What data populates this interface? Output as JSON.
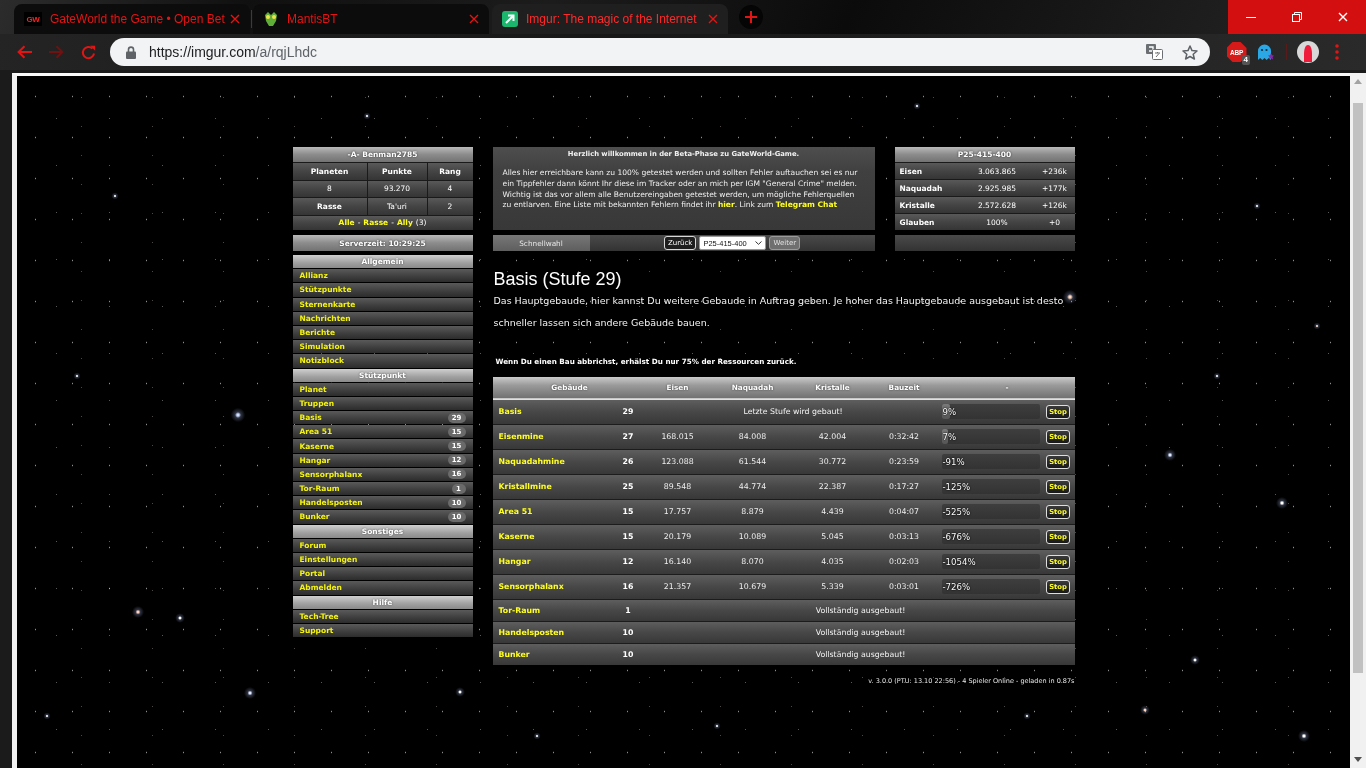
{
  "browser": {
    "tabs": [
      {
        "kind": "gw",
        "favicon_text": "GW",
        "title": "GateWorld the Game • Open Bet",
        "selected": false
      },
      {
        "kind": "mantis",
        "title": "MantisBT",
        "selected": false
      },
      {
        "kind": "imgur",
        "title": "Imgur: The magic of the Internet",
        "selected": true
      }
    ],
    "url": {
      "origin": "https://imgur.com",
      "path": "/a/rqjLhdc"
    },
    "extensions": [
      {
        "kind": "abp",
        "label": "ABP",
        "badge": "4"
      },
      {
        "kind": "ghost"
      }
    ]
  },
  "player_panel": {
    "title": "-A- Benman2785",
    "columns": [
      "Planeten",
      "Punkte",
      "Rang"
    ],
    "rows": [
      {
        "kind": "values",
        "cells": [
          "8",
          "93.270",
          "4"
        ]
      },
      {
        "kind": "labeled",
        "cells": [
          "Rasse",
          "Ta'uri",
          "2"
        ]
      }
    ],
    "filters": [
      {
        "kind": "link",
        "text": "Alle"
      },
      {
        "kind": "separator",
        "text": "-"
      },
      {
        "kind": "link",
        "text": "Rasse"
      },
      {
        "kind": "separator",
        "text": "-"
      },
      {
        "kind": "link",
        "text": "Ally"
      },
      {
        "kind": "count",
        "text": "(3)"
      }
    ]
  },
  "server_time": "Serverzeit: 10:29:25",
  "nav": [
    {
      "title": "Allgemein",
      "items": [
        {
          "label": "Allianz"
        },
        {
          "label": "Stützpunkte"
        },
        {
          "label": "Sternenkarte"
        },
        {
          "label": "Nachrichten"
        },
        {
          "label": "Berichte"
        },
        {
          "label": "Simulation"
        },
        {
          "label": "Notizblock"
        }
      ]
    },
    {
      "title": "Stützpunkt",
      "items": [
        {
          "label": "Planet"
        },
        {
          "label": "Truppen"
        },
        {
          "label": "Basis",
          "count": "29"
        },
        {
          "label": "Area 51",
          "count": "15"
        },
        {
          "label": "Kaserne",
          "count": "15"
        },
        {
          "label": "Hangar",
          "count": "12"
        },
        {
          "label": "Sensorphalanx",
          "count": "16"
        },
        {
          "label": "Tor-Raum",
          "count": "1"
        },
        {
          "label": "Handelsposten",
          "count": "10"
        },
        {
          "label": "Bunker",
          "count": "10"
        }
      ]
    },
    {
      "title": "Sonstiges",
      "items": [
        {
          "label": "Forum"
        },
        {
          "label": "Einstellungen"
        },
        {
          "label": "Portal"
        },
        {
          "label": "Abmelden"
        }
      ]
    },
    {
      "title": "Hilfe",
      "items": [
        {
          "label": "Tech-Tree"
        },
        {
          "label": "Support"
        }
      ]
    }
  ],
  "welcome": {
    "title": "Herzlich willkommen in der Beta-Phase zu GateWorld-Game.",
    "paragraph": [
      {
        "kind": "text",
        "text": "Alles hier erreichbare kann zu 100% getestet werden und sollten Fehler auftauchen sei es nur ein Tippfehler dann könnt Ihr diese im Tracker oder an mich per IGM \"General Crime\" melden. Wichtig ist das vor allem alle Benutzereingaben getestet werden, um mögliche Fehlerquellen zu entlarven. Eine Liste mit bekannten Fehlern findet ihr "
      },
      {
        "kind": "link",
        "text": "hier"
      },
      {
        "kind": "text",
        "text": ". Link zum "
      },
      {
        "kind": "link",
        "text": "Telegram Chat"
      }
    ]
  },
  "quick_select": {
    "tab": "Schnellwahl",
    "back": "Zurück",
    "planet": "P25-415-400",
    "next": {
      "label": "Weiter",
      "disabled": true
    }
  },
  "resources": {
    "title": "P25-415-400",
    "rows": [
      {
        "name": "Eisen",
        "amount": "3.063.865",
        "rate": "+236k"
      },
      {
        "name": "Naquadah",
        "amount": "2.925.985",
        "rate": "+177k"
      },
      {
        "name": "Kristalle",
        "amount": "2.572.628",
        "rate": "+126k"
      },
      {
        "name": "Glauben",
        "amount": "100%",
        "rate": "+0"
      }
    ]
  },
  "building": {
    "title": "Basis (Stufe 29)",
    "description": "Das Hauptgebaude, hier kannst Du weitere Gebaude in Auftrag geben. Je hoher das Hauptgebaude ausgebaut ist desto schneller lassen sich andere Gebäude bauen.",
    "warning": "Wenn Du einen Bau abbrichst, erhälst Du nur 75% der Ressourcen zurück."
  },
  "queue_table": {
    "columns": [
      "Gebäude",
      "Eisen",
      "Naquadah",
      "Kristalle",
      "Bauzeit",
      "-"
    ],
    "rows": [
      {
        "kind": "current",
        "name": "Basis",
        "level": "29",
        "note": "Letzte Stufe wird gebaut!",
        "progress": {
          "level": 0.09,
          "reading": "9%"
        },
        "action": "Stop"
      },
      {
        "kind": "queued",
        "name": "Eisenmine",
        "level": "27",
        "costs": [
          "168.015",
          "84.008",
          "42.004"
        ],
        "time": "0:32:42",
        "progress": {
          "level": 0.07,
          "reading": "7%"
        },
        "action": "Stop"
      },
      {
        "kind": "queued",
        "name": "Naquadahmine",
        "level": "26",
        "costs": [
          "123.088",
          "61.544",
          "30.772"
        ],
        "time": "0:23:59",
        "progress": {
          "level": 0,
          "reading": "-91%"
        },
        "action": "Stop"
      },
      {
        "kind": "queued",
        "name": "Kristallmine",
        "level": "25",
        "costs": [
          "89.548",
          "44.774",
          "22.387"
        ],
        "time": "0:17:27",
        "progress": {
          "level": 0,
          "reading": "-125%"
        },
        "action": "Stop"
      },
      {
        "kind": "queued",
        "name": "Area 51",
        "level": "15",
        "costs": [
          "17.757",
          "8.879",
          "4.439"
        ],
        "time": "0:04:07",
        "progress": {
          "level": 0,
          "reading": "-525%"
        },
        "action": "Stop"
      },
      {
        "kind": "queued",
        "name": "Kaserne",
        "level": "15",
        "costs": [
          "20.179",
          "10.089",
          "5.045"
        ],
        "time": "0:03:13",
        "progress": {
          "level": 0,
          "reading": "-676%"
        },
        "action": "Stop"
      },
      {
        "kind": "queued",
        "name": "Hangar",
        "level": "12",
        "costs": [
          "16.140",
          "8.070",
          "4.035"
        ],
        "time": "0:02:03",
        "progress": {
          "level": 0,
          "reading": "-1054%"
        },
        "action": "Stop"
      },
      {
        "kind": "queued",
        "name": "Sensorphalanx",
        "level": "16",
        "costs": [
          "21.357",
          "10.679",
          "5.339"
        ],
        "time": "0:03:01",
        "progress": {
          "level": 0,
          "reading": "-726%"
        },
        "action": "Stop"
      },
      {
        "kind": "complete",
        "name": "Tor-Raum",
        "level": "1",
        "note": "Vollständig ausgebaut!"
      },
      {
        "kind": "complete",
        "name": "Handelsposten",
        "level": "10",
        "note": "Vollständig ausgebaut!"
      },
      {
        "kind": "complete",
        "name": "Bunker",
        "level": "10",
        "note": "Vollständig ausgebaut!"
      }
    ]
  },
  "footer": "v. 3.0.0 (PTU: 13.10 22:56) - 4 Spieler Online - geladen in 0.87s"
}
